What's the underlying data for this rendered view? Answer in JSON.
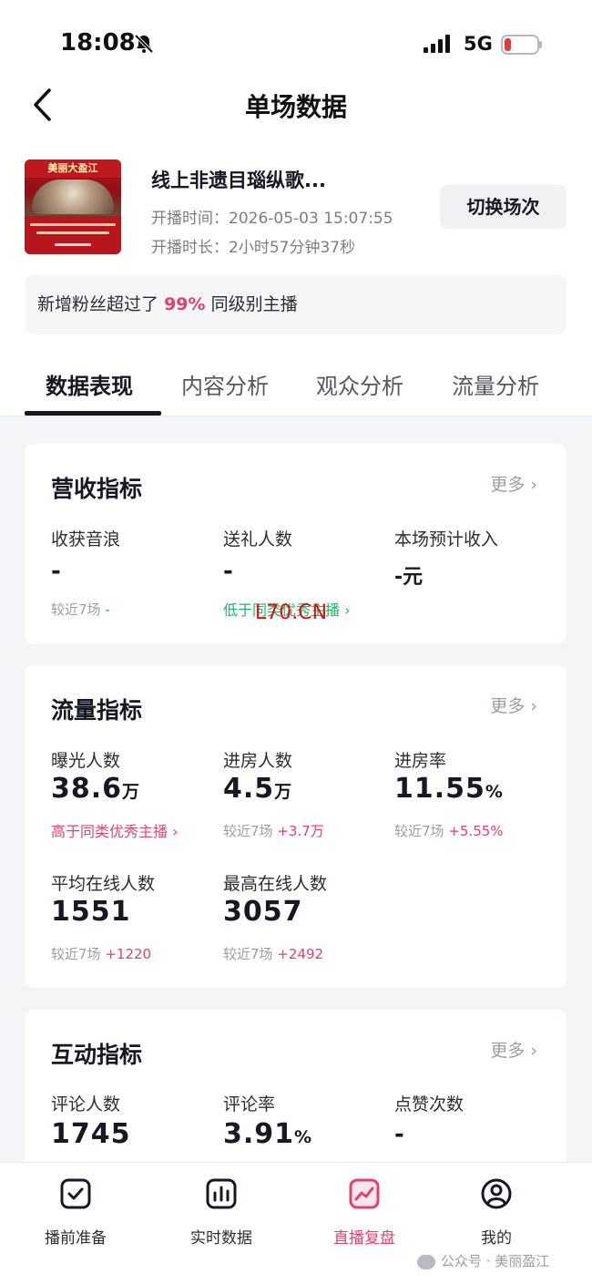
{
  "status_bar": {
    "time": "18:08",
    "network": "5G"
  },
  "header": {
    "title": "单场数据"
  },
  "live": {
    "thumb_banner": "美丽大盈江",
    "title": "线上非遗目瑙纵歌...",
    "start_label": "开播时间：",
    "start_value": "2026-05-03 15:07:55",
    "duration_label": "开播时长：",
    "duration_value": "2小时57分钟37秒",
    "switch_label": "切换场次"
  },
  "fans_notice": {
    "prefix": "新增粉丝超过了",
    "highlight": "99%",
    "suffix": "同级别主播"
  },
  "tabs": [
    {
      "label": "数据表现",
      "active": true
    },
    {
      "label": "内容分析",
      "active": false
    },
    {
      "label": "观众分析",
      "active": false
    },
    {
      "label": "流量分析",
      "active": false
    }
  ],
  "revenue": {
    "title": "营收指标",
    "more": "更多",
    "m1": {
      "label": "收获音浪",
      "value": "-",
      "sub": "较近7场",
      "delta": "-"
    },
    "m2": {
      "label": "送礼人数",
      "value": "-",
      "tag": "低于同类优秀主播"
    },
    "m3": {
      "label": "本场预计收入",
      "value": "-元"
    }
  },
  "watermark": "L70.CN",
  "traffic": {
    "title": "流量指标",
    "more": "更多",
    "m1": {
      "label": "曝光人数",
      "value": "38.6",
      "unit": "万",
      "tag": "高于同类优秀主播"
    },
    "m2": {
      "label": "进房人数",
      "value": "4.5",
      "unit": "万",
      "sub": "较近7场",
      "delta": "+3.7万"
    },
    "m3": {
      "label": "进房率",
      "value": "11.55",
      "unit": "%",
      "sub": "较近7场",
      "delta": "+5.55%"
    },
    "m4": {
      "label": "平均在线人数",
      "value": "1551",
      "sub": "较近7场",
      "delta": "+1220"
    },
    "m5": {
      "label": "最高在线人数",
      "value": "3057",
      "sub": "较近7场",
      "delta": "+2492"
    }
  },
  "interaction": {
    "title": "互动指标",
    "more": "更多",
    "m1": {
      "label": "评论人数",
      "value": "1745"
    },
    "m2": {
      "label": "评论率",
      "value": "3.91",
      "unit": "%"
    },
    "m3": {
      "label": "点赞次数",
      "value": "-"
    }
  },
  "bottom_nav": [
    {
      "label": "播前准备",
      "icon": "checklist-icon",
      "active": false
    },
    {
      "label": "实时数据",
      "icon": "bar-chart-icon",
      "active": false
    },
    {
      "label": "直播复盘",
      "icon": "trend-chart-icon",
      "active": true
    },
    {
      "label": "我的",
      "icon": "profile-icon",
      "active": false
    }
  ],
  "footer_mark": "公众号 · 美丽盈江",
  "colors": {
    "accent": "#e0426e",
    "positive_green": "#21b46a",
    "text_primary": "#161823",
    "text_secondary": "#9a9da4"
  }
}
